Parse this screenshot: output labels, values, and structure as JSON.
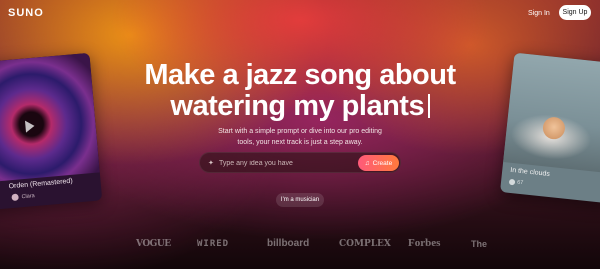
{
  "header": {
    "logo": "SUNO",
    "sign_in": "Sign In",
    "sign_up": "Sign Up"
  },
  "hero": {
    "headline_line1": "Make a jazz song about",
    "headline_line2": "watering my plants",
    "subtitle": "Start with a simple prompt or dive into our pro editing tools, your next track is just a step away."
  },
  "prompt": {
    "placeholder": "Type any idea you have",
    "create_label": "Create"
  },
  "musician_button": "I'm a musician",
  "cards": [
    {
      "title": "Orden (Remastered)",
      "artist": "Clara"
    },
    {
      "title": "In the clouds",
      "artist": "67"
    }
  ],
  "brands": [
    "VOGUE",
    "WIRED",
    "billboard",
    "COMPLEX",
    "Forbes",
    "The"
  ],
  "colors": {
    "accent_start": "#ff5a7a",
    "accent_end": "#ff7a3c"
  }
}
